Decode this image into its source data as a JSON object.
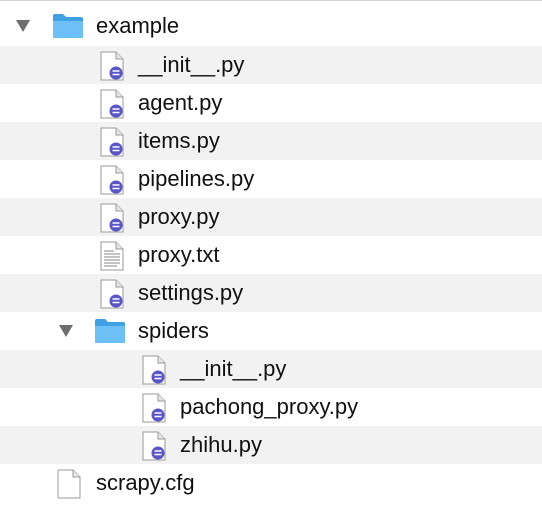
{
  "colors": {
    "folder": "#5bb4f0",
    "folder_tab": "#3fa0e4",
    "python_badge": "#5a55c8",
    "row_alt": "#f2f2f2"
  },
  "tree": {
    "items": [
      {
        "label": "example",
        "icon": "folder-icon",
        "expanded": true
      },
      {
        "label": "__init__.py",
        "icon": "python-file-icon"
      },
      {
        "label": "agent.py",
        "icon": "python-file-icon"
      },
      {
        "label": "items.py",
        "icon": "python-file-icon"
      },
      {
        "label": "pipelines.py",
        "icon": "python-file-icon"
      },
      {
        "label": "proxy.py",
        "icon": "python-file-icon"
      },
      {
        "label": "proxy.txt",
        "icon": "text-file-icon"
      },
      {
        "label": "settings.py",
        "icon": "python-file-icon"
      },
      {
        "label": "spiders",
        "icon": "folder-icon",
        "expanded": true
      },
      {
        "label": "__init__.py",
        "icon": "python-file-icon"
      },
      {
        "label": "pachong_proxy.py",
        "icon": "python-file-icon"
      },
      {
        "label": "zhihu.py",
        "icon": "python-file-icon"
      },
      {
        "label": "scrapy.cfg",
        "icon": "blank-file-icon"
      }
    ]
  }
}
